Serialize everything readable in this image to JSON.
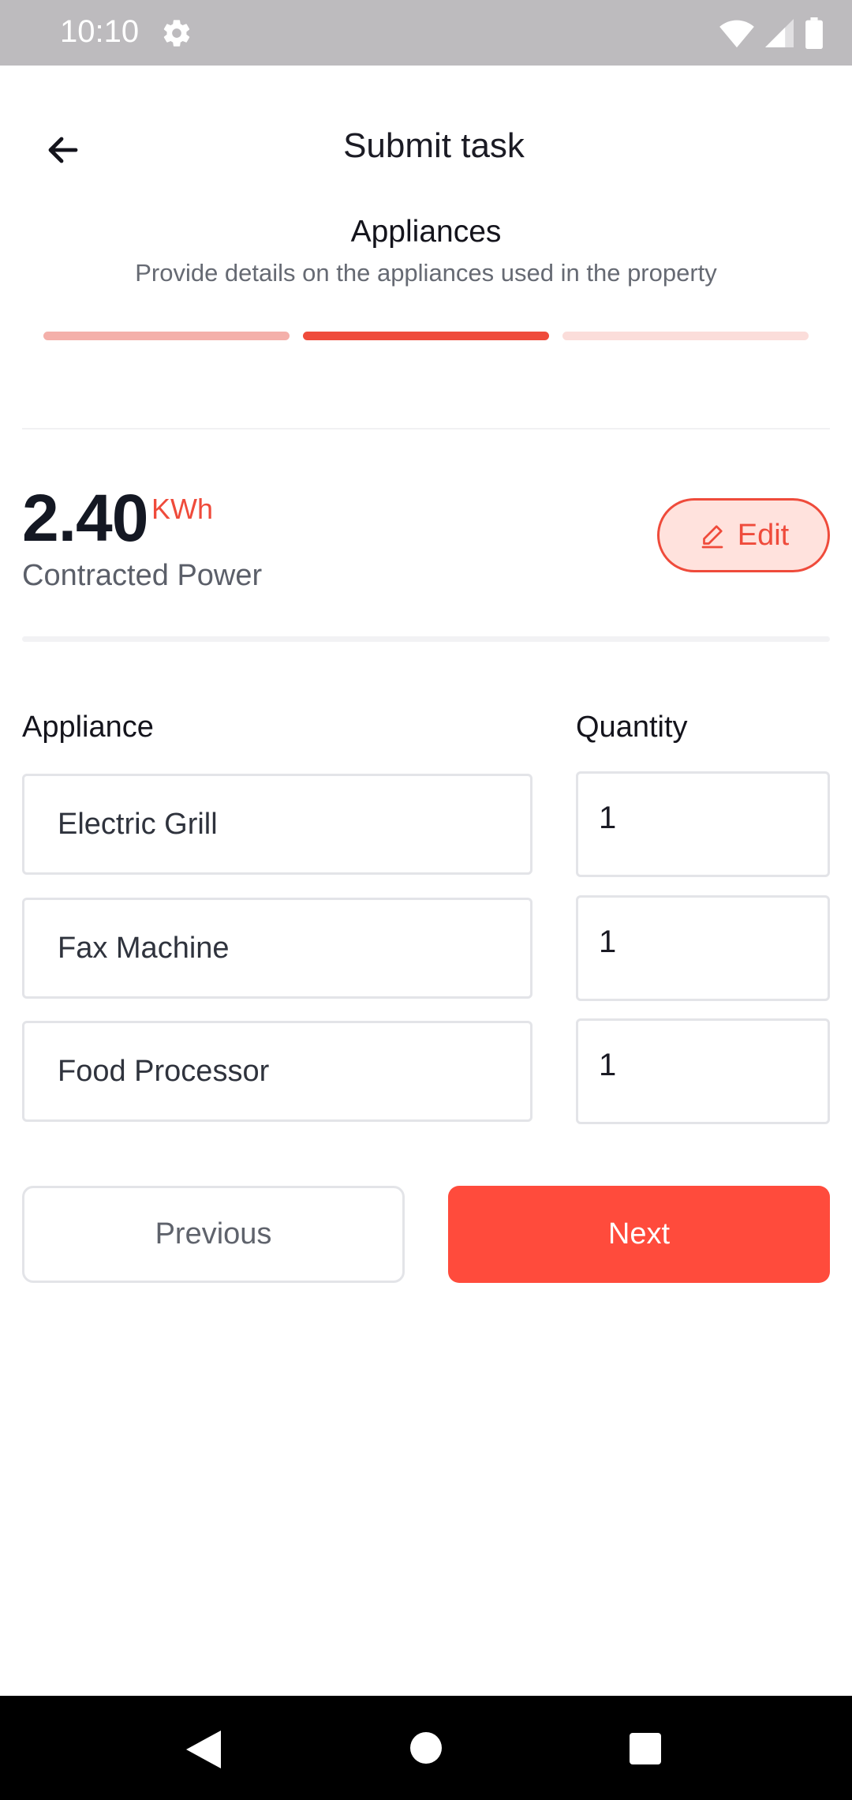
{
  "status_bar": {
    "time": "10:10"
  },
  "header": {
    "title": "Submit task"
  },
  "step": {
    "title": "Appliances",
    "subtitle": "Provide details on the appliances used in the property",
    "progress": {
      "total_steps": 3,
      "current_step": 2
    }
  },
  "power": {
    "value": "2.40",
    "unit": "KWh",
    "label": "Contracted Power",
    "edit_label": "Edit"
  },
  "table": {
    "appliance_header": "Appliance",
    "quantity_header": "Quantity",
    "rows": [
      {
        "appliance": "Electric Grill",
        "quantity": "1"
      },
      {
        "appliance": "Fax Machine",
        "quantity": "1"
      },
      {
        "appliance": "Food Processor",
        "quantity": "1"
      }
    ]
  },
  "actions": {
    "previous_label": "Previous",
    "next_label": "Next"
  },
  "colors": {
    "accent": "#FF4B3C",
    "progress_done": "#F4B0AA",
    "progress_current": "#EF4B3B",
    "progress_todo": "#FBDDDA",
    "edit_bg": "#FFE2DD"
  },
  "icons": {
    "back": "arrow-left-icon",
    "edit": "pencil-icon",
    "settings": "gear-icon",
    "wifi": "wifi-icon",
    "signal": "signal-icon",
    "battery": "battery-icon"
  }
}
